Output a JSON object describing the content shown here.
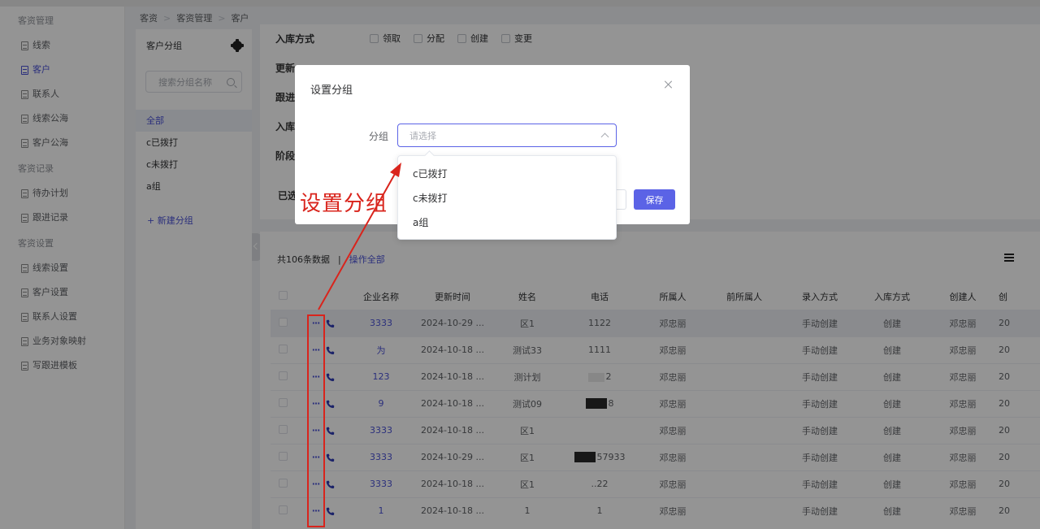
{
  "sidebar": {
    "sections": [
      {
        "title": "客资管理",
        "items": [
          "线索",
          "客户",
          "联系人",
          "线索公海",
          "客户公海"
        ]
      },
      {
        "title": "客资记录",
        "items": [
          "待办计划",
          "跟进记录"
        ]
      },
      {
        "title": "客资设置",
        "items": [
          "线索设置",
          "客户设置",
          "联系人设置",
          "业务对象映射",
          "写跟进模板"
        ]
      }
    ],
    "active": "客户"
  },
  "breadcrumb": [
    "客资",
    "客资管理",
    "客户"
  ],
  "group_panel": {
    "title": "客户分组",
    "search_placeholder": "搜索分组名称",
    "items": [
      "全部",
      "c已拨打",
      "c未拨打",
      "a组"
    ],
    "new_label": "+ 新建分组"
  },
  "filters": {
    "row1_label": "入库方式",
    "row1_options": [
      "领取",
      "分配",
      "创建",
      "变更"
    ],
    "row2_label": "更新",
    "row3_label": "跟进",
    "row4_label": "入库",
    "row5_label": "阶段",
    "row6_label": "已选"
  },
  "table": {
    "summary": "共106条数据",
    "sep": "|",
    "op_all": "操作全部",
    "columns": [
      "企业名称",
      "更新时间",
      "姓名",
      "电话",
      "所属人",
      "前所属人",
      "录入方式",
      "入库方式",
      "创建人",
      "创"
    ],
    "rows": [
      {
        "company": "3333",
        "updated": "2024-10-29 ...",
        "name": "区1",
        "phone": "1122",
        "owner": "邓忠丽",
        "prev_owner": "",
        "entry": "手动创建",
        "storage": "创建",
        "creator": "邓忠丽",
        "extra": "20"
      },
      {
        "company": "为",
        "updated": "2024-10-18 ...",
        "name": "测试33",
        "phone": "1111",
        "owner": "邓忠丽",
        "prev_owner": "",
        "entry": "手动创建",
        "storage": "创建",
        "creator": "邓忠丽",
        "extra": "20"
      },
      {
        "company": "123",
        "updated": "2024-10-18 ...",
        "name": "测计划",
        "phone": "2",
        "owner": "邓忠丽",
        "prev_owner": "",
        "entry": "手动创建",
        "storage": "创建",
        "creator": "邓忠丽",
        "extra": "20"
      },
      {
        "company": "9",
        "updated": "2024-10-18 ...",
        "name": "测试09",
        "phone": "8",
        "owner": "邓忠丽",
        "prev_owner": "",
        "entry": "手动创建",
        "storage": "创建",
        "creator": "邓忠丽",
        "extra": "20"
      },
      {
        "company": "3333",
        "updated": "2024-10-18 ...",
        "name": "区1",
        "phone": "",
        "owner": "邓忠丽",
        "prev_owner": "",
        "entry": "手动创建",
        "storage": "创建",
        "creator": "邓忠丽",
        "extra": "20"
      },
      {
        "company": "3333",
        "updated": "2024-10-29 ...",
        "name": "区1",
        "phone": "57933",
        "owner": "邓忠丽",
        "prev_owner": "",
        "entry": "手动创建",
        "storage": "创建",
        "creator": "邓忠丽",
        "extra": "20"
      },
      {
        "company": "3333",
        "updated": "2024-10-18 ...",
        "name": "区1",
        "phone": "..22",
        "owner": "邓忠丽",
        "prev_owner": "",
        "entry": "手动创建",
        "storage": "创建",
        "creator": "邓忠丽",
        "extra": "20"
      },
      {
        "company": "1",
        "updated": "2024-10-18 ...",
        "name": "1",
        "phone": "1",
        "owner": "邓忠丽",
        "prev_owner": "",
        "entry": "手动创建",
        "storage": "创建",
        "creator": "邓忠丽",
        "extra": "20"
      }
    ],
    "row_action_dots": "···"
  },
  "modal": {
    "title": "设置分组",
    "field_label": "分组",
    "placeholder": "请选择",
    "options": [
      "c已拨打",
      "c未拨打",
      "a组"
    ],
    "save_label": "保存"
  },
  "annotation": {
    "text": "设置分组",
    "color": "#d9241c"
  },
  "colors": {
    "accent": "#4b52d6",
    "primary_button": "#5b63e6"
  }
}
